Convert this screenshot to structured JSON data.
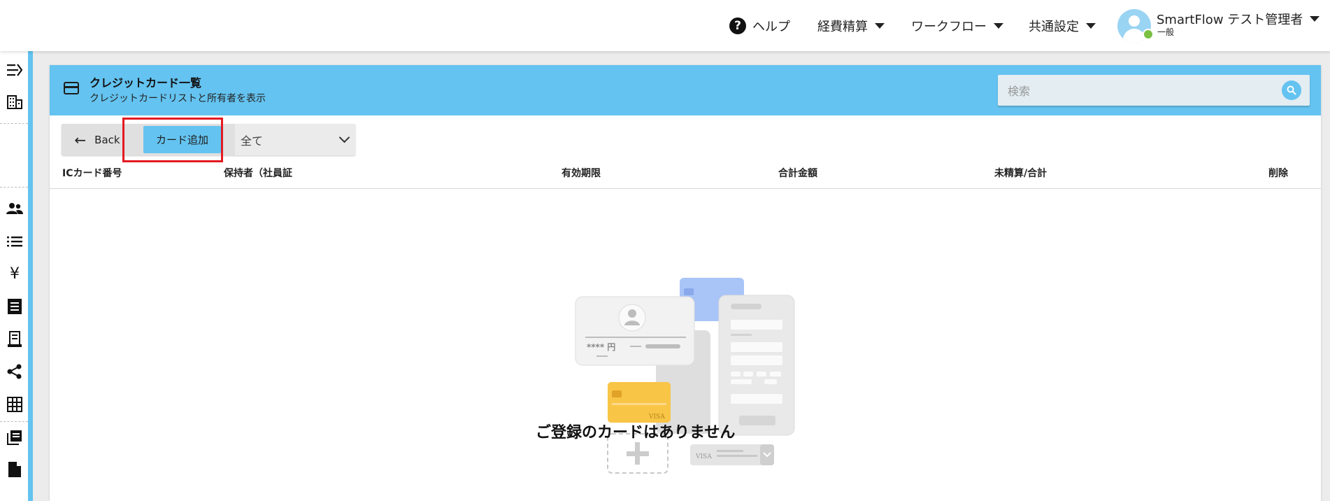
{
  "topbar": {
    "help_label": "ヘルプ",
    "menu": [
      "経費精算",
      "ワークフロー",
      "共通設定"
    ],
    "user_name": "SmartFlow テスト管理者",
    "user_role": "一般"
  },
  "sidebar": {
    "icons": [
      "expand-menu-icon",
      "building-icon",
      "people-icon",
      "list-icon",
      "yen-icon",
      "document-list-icon",
      "receipt-icon",
      "share-icon",
      "grid-icon",
      "library-icon",
      "file-icon"
    ]
  },
  "panel": {
    "title": "クレジットカード一覧",
    "subtitle": "クレジットカードリストと所有者を表示",
    "search_placeholder": "検索"
  },
  "toolbar": {
    "back_label": "Back",
    "add_label": "カード追加",
    "filter_value": "全て"
  },
  "table": {
    "columns": [
      "ICカード番号",
      "保持者（社員証",
      "有効期限",
      "合計金額",
      "未精算/合計",
      "削除"
    ]
  },
  "empty_state": {
    "card_amount": "**** 円",
    "card_brand": "VISA",
    "message": "ご登録のカードはありません"
  },
  "colors": {
    "accent": "#64c3f0",
    "highlight": "#e21a22"
  }
}
